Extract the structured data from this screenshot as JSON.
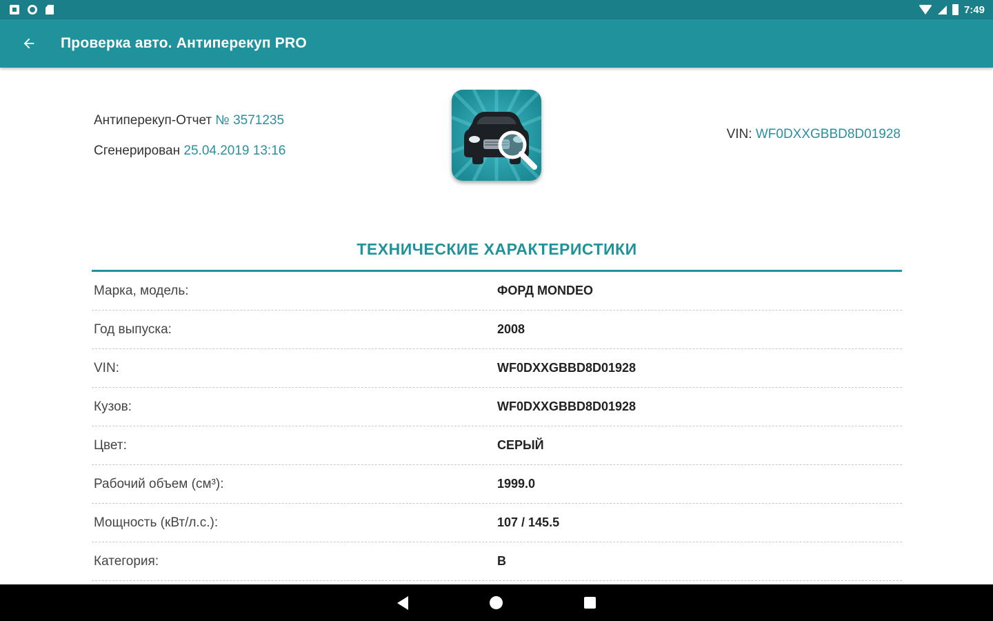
{
  "status_bar": {
    "time": "7:49",
    "left_icons": [
      "notification-icon",
      "sync-icon",
      "sd-card-icon"
    ],
    "right_icons": [
      "wifi-icon",
      "signal-icon",
      "battery-icon"
    ]
  },
  "app_bar": {
    "title": "Проверка авто. Антиперекуп PRO",
    "back_icon": "arrow-left-icon"
  },
  "report": {
    "number_label": "Антиперекуп-Отчет",
    "number_value": "№ 3571235",
    "generated_label": "Сгенерирован",
    "generated_value": "25.04.2019 13:16",
    "vin_label": "VIN:",
    "vin_value": "WF0DXXGBBD8D01928"
  },
  "logo": {
    "icon": "car-search-icon"
  },
  "section": {
    "title": "ТЕХНИЧЕСКИЕ ХАРАКТЕРИСТИКИ",
    "rows": [
      {
        "label": "Марка, модель:",
        "value": "ФОРД MONDEO"
      },
      {
        "label": "Год выпуска:",
        "value": "2008"
      },
      {
        "label": "VIN:",
        "value": "WF0DXXGBBD8D01928"
      },
      {
        "label": "Кузов:",
        "value": "WF0DXXGBBD8D01928"
      },
      {
        "label": "Цвет:",
        "value": "СЕРЫЙ"
      },
      {
        "label": "Рабочий объем (см³):",
        "value": "1999.0"
      },
      {
        "label": "Мощность (кВт/л.с.):",
        "value": "107 / 145.5"
      },
      {
        "label": "Категория:",
        "value": "B"
      }
    ]
  },
  "nav_bar": {
    "icons": [
      "nav-back-icon",
      "nav-home-icon",
      "nav-recents-icon"
    ]
  },
  "colors": {
    "primary": "#20929b",
    "status_bar": "#1a7f89",
    "accent_text": "#2a8fa0"
  }
}
